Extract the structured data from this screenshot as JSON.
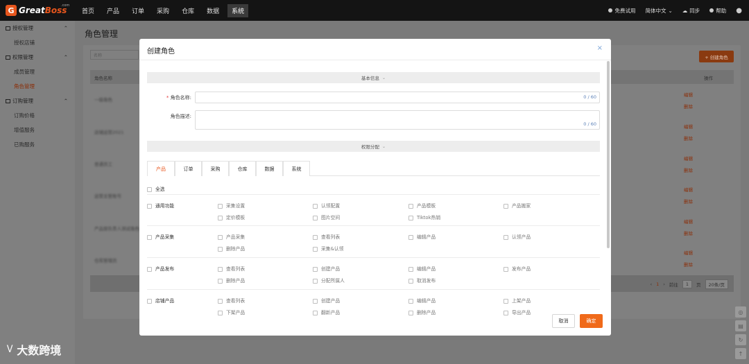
{
  "app": {
    "logo_mark": "G",
    "logo_text_a": "Great",
    "logo_text_b": "Boss",
    "logo_com": ".com",
    "nav": [
      "首页",
      "产品",
      "订单",
      "采购",
      "仓库",
      "数据",
      "系统"
    ],
    "nav_active": "系统",
    "right": {
      "trial": "免费试用",
      "lang": "简体中文",
      "sync": "同步",
      "help": "帮助"
    }
  },
  "sidebar": {
    "groups": [
      {
        "label": "授权管理",
        "icon": "grid-icon",
        "items": [
          {
            "label": "授权店铺",
            "active": false
          }
        ]
      },
      {
        "label": "权限管理",
        "icon": "user-icon",
        "items": [
          {
            "label": "成员管理",
            "active": false
          },
          {
            "label": "角色管理",
            "active": true
          }
        ]
      },
      {
        "label": "订购管理",
        "icon": "order-icon",
        "items": [
          {
            "label": "订购价格",
            "active": false
          },
          {
            "label": "增值服务",
            "active": false
          },
          {
            "label": "已购服务",
            "active": false
          }
        ]
      }
    ]
  },
  "page": {
    "title": "角色管理",
    "filter_placeholder": "名称",
    "create_button": "+ 创建角色",
    "col_name": "角色名称",
    "col_ops": "操作",
    "rows": [
      "一级角色",
      "店铺运营2021",
      "普通员工",
      "运营主管账号",
      "产品部负责人测试角色名称",
      "仓库管理员"
    ],
    "edit": "编辑",
    "delete": "删除",
    "pager": {
      "page": "1",
      "goto": "前往",
      "goto_val": "1",
      "page_unit": "页",
      "size": "20条/页"
    }
  },
  "watermark": {
    "symbol": "Ꮩ",
    "text": "大数跨境"
  },
  "modal": {
    "title": "创建角色",
    "close": "×",
    "section_basic": "基本信息",
    "name_label": "角色名称:",
    "name_required": "*",
    "name_counter": "0 / 60",
    "desc_label": "角色描述:",
    "desc_counter": "0 / 60",
    "section_perm": "权限分配",
    "tabs": [
      "产品",
      "订单",
      "采购",
      "仓库",
      "数据",
      "系统"
    ],
    "active_tab": "产品",
    "select_all": "全选",
    "groups": [
      {
        "label": "通用功能",
        "items": [
          "采集设置",
          "认领配置",
          "产品模板",
          "产品搬家",
          "定价模板",
          "图片空间",
          "Tiktok热销"
        ]
      },
      {
        "label": "产品采集",
        "items": [
          "产品采集",
          "查看列表",
          "编辑产品",
          "认领产品",
          "删除产品",
          "采集&认领"
        ]
      },
      {
        "label": "产品发布",
        "items": [
          "查看列表",
          "创建产品",
          "编辑产品",
          "发布产品",
          "删除产品",
          "分配所属人",
          "取消发布"
        ]
      },
      {
        "label": "店铺产品",
        "items": [
          "查看列表",
          "创建产品",
          "编辑产品",
          "上架产品",
          "下架产品",
          "翻新产品",
          "删除产品",
          "导出产品"
        ]
      }
    ],
    "cancel": "取消",
    "confirm": "确定"
  }
}
